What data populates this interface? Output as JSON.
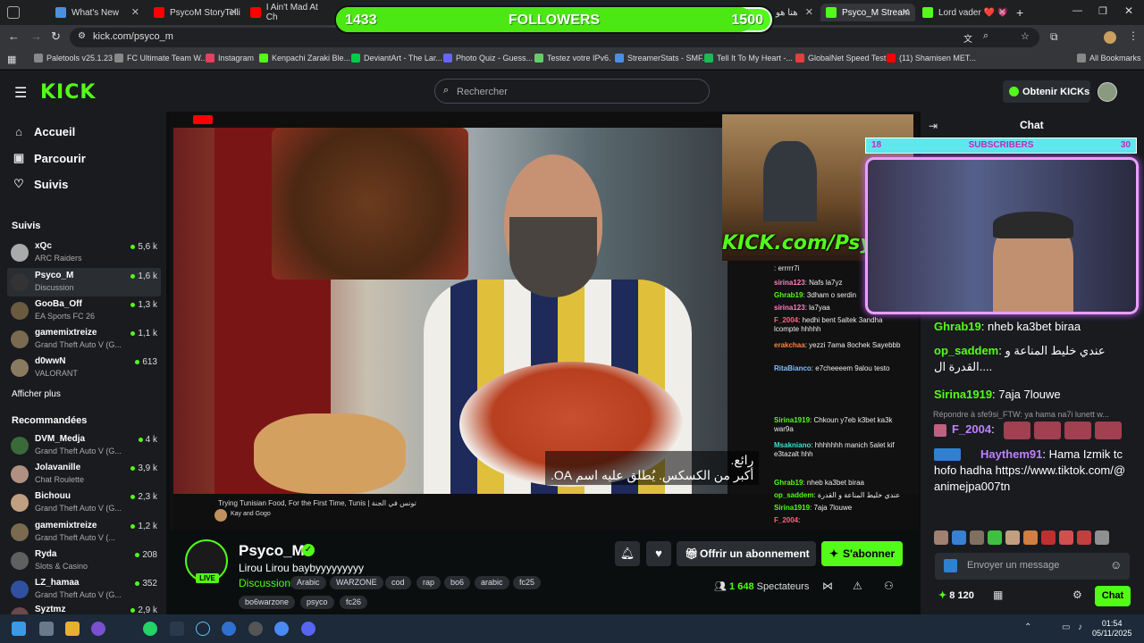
{
  "tabs": [
    {
      "label": "What's New",
      "color": "#4a90e2"
    },
    {
      "label": "PsycoM StoryTelli",
      "color": "#ff0000"
    },
    {
      "label": "I Ain't Mad At Ch",
      "color": "#ff0000"
    },
    {
      "label": "هنا هو",
      "color": "#ff0000"
    },
    {
      "label": "Psyco_M Stream",
      "color": "#53fc18"
    },
    {
      "label": "Lord vader ❤️ 💗",
      "color": "#53fc18"
    }
  ],
  "url": "kick.com/psyco_m",
  "bookmarks": [
    {
      "label": "Paletools v25.1.23",
      "color": "#888"
    },
    {
      "label": "FC Ultimate Team W...",
      "color": "#888"
    },
    {
      "label": "Instagram",
      "color": "#e4405f"
    },
    {
      "label": "Kenpachi Zaraki Ble...",
      "color": "#53fc18"
    },
    {
      "label": "DeviantArt - The Lar...",
      "color": "#05cc47"
    },
    {
      "label": "Photo Quiz - Guess...",
      "color": "#6666ff"
    },
    {
      "label": "Testez votre IPv6.",
      "color": "#66cc66"
    },
    {
      "label": "StreamerStats - SMF...",
      "color": "#4a90e2"
    },
    {
      "label": "Tell It To My Heart -...",
      "color": "#1db954"
    },
    {
      "label": "GlobalNet Speed Test",
      "color": "#e04040"
    },
    {
      "label": "(11) Shamisen MET...",
      "color": "#ff0000"
    },
    {
      "label": "All Bookmarks",
      "color": "#888"
    }
  ],
  "header": {
    "logo": "KICK",
    "search_placeholder": "Rechercher",
    "get_kicks": "Obtenir KICKs"
  },
  "nav": {
    "home": "Accueil",
    "browse": "Parcourir",
    "following": "Suivis"
  },
  "following_title": "Suivis",
  "following": [
    {
      "name": "xQc",
      "game": "ARC Raiders",
      "viewers": "5,6 k"
    },
    {
      "name": "Psyco_M",
      "game": "Discussion",
      "viewers": "1,6 k"
    },
    {
      "name": "GooBa_Off",
      "game": "EA Sports FC 26",
      "viewers": "1,3 k"
    },
    {
      "name": "gamemixtreize",
      "game": "Grand Theft Auto V (G...",
      "viewers": "1,1 k"
    },
    {
      "name": "d0wwN",
      "game": "VALORANT",
      "viewers": "613"
    }
  ],
  "show_more": "Afficher plus",
  "recommended_title": "Recommandées",
  "recommended": [
    {
      "name": "DVM_Medja",
      "game": "Grand Theft Auto V (G...",
      "viewers": "4 k"
    },
    {
      "name": "Jolavanille",
      "game": "Chat Roulette",
      "viewers": "3,9 k"
    },
    {
      "name": "Bichouu",
      "game": "Grand Theft Auto V (G...",
      "viewers": "2,3 k"
    },
    {
      "name": "gamemixtreize",
      "game": "Grand Theft Auto V (...",
      "viewers": "1,2 k"
    },
    {
      "name": "Ryda",
      "game": "Slots & Casino",
      "viewers": "208"
    },
    {
      "name": "LZ_hamaa",
      "game": "Grand Theft Auto V (G...",
      "viewers": "352"
    },
    {
      "name": "Syztmz",
      "game": "",
      "viewers": "2,9 k"
    }
  ],
  "followers_goal": {
    "current": "1433",
    "label": "FOLLOWERS",
    "target": "1500",
    "progress": 0.955
  },
  "subs_goal": {
    "current": "18",
    "label": "SUBSCRIBERS",
    "target": "30"
  },
  "video": {
    "yt_title": "Trying Tunisian Food, For the First Time, Tunis | تونس في الجنة",
    "yt_channel": "Kay and Gogo",
    "subtitle_line1": "رائع.",
    "subtitle_line2": "أكبر من الكسكس. يُطلق عليه اسم OA.",
    "banner": "KICK.com/Psy"
  },
  "overlay_chat": [
    {
      "user": "",
      "text": ": errrrr7i"
    },
    {
      "user": "sirina123",
      "text": ": Nafs la7yz"
    },
    {
      "user": "Ghrab19",
      "text": ": 3dham o serdin"
    },
    {
      "user": "sirina123",
      "text": ": la7yaa"
    },
    {
      "user": "F_2004",
      "text": ": hedhi bent 5altek 3andha lcompte hhhhh"
    },
    {
      "user": "erakchaa",
      "text": ": yezzi 7ama 8ochek Sayebbb"
    },
    {
      "user": "RitaBianco",
      "text": ": e7cheeeem 9alou testo"
    },
    {
      "user": "Sirina1919",
      "text": ": Chkoun y7eb k3bet ka3k war9a"
    },
    {
      "user": "Msakniano",
      "text": ": hhhhhhh manich 5alet kif e3tazalt hhh"
    },
    {
      "user": "Ghrab19",
      "text": ": nheb ka3bet biraa"
    },
    {
      "user": "op_saddem",
      "text": ": عندي خليط المناعة و القدرة ال"
    },
    {
      "user": "Sirina1919",
      "text": ": 7aja 7louwe"
    },
    {
      "user": "F_2004",
      "text": ":"
    }
  ],
  "stream": {
    "name": "Psyco_M",
    "title": "Lirou Lirou baybyyyyyyyyy",
    "category": "Discussion",
    "tags": [
      "Arabic",
      "WARZONE",
      "cod",
      "rap",
      "bo6",
      "arabic",
      "fc25",
      "bo6warzone",
      "psyco",
      "fc26"
    ],
    "live": "LIVE",
    "offer": "Offrir un abonnement",
    "subscribe": "S'abonner",
    "viewers": "1 648",
    "viewers_label": "Spectateurs"
  },
  "chat": {
    "title": "Chat",
    "messages": [
      {
        "user": "Ghrab19",
        "text": ": nheb ka3bet biraa",
        "color": "#53fc18"
      },
      {
        "user": "op_saddem",
        "text": ": عندي خليط المناعة و القدرة ال....",
        "color": "#53fc18"
      },
      {
        "user": "Sirina1919",
        "text": ": 7aja 7louwe",
        "color": "#53fc18"
      },
      {
        "user": "F_2004",
        "text": ":",
        "color": "#c080ff"
      },
      {
        "user": "Haythem91",
        "text": ": Hama Izmik tchofo hadha https://www.tiktok.com/@animejpa007tn",
        "color": "#c080ff"
      }
    ],
    "reply_note": "Répondre à sfe9si_FTW: ya hama na7i lunett w...",
    "input_placeholder": "Envoyer un message",
    "points": "8 120",
    "send": "Chat"
  },
  "clock": {
    "time": "01:54",
    "date": "05/11/2025"
  }
}
